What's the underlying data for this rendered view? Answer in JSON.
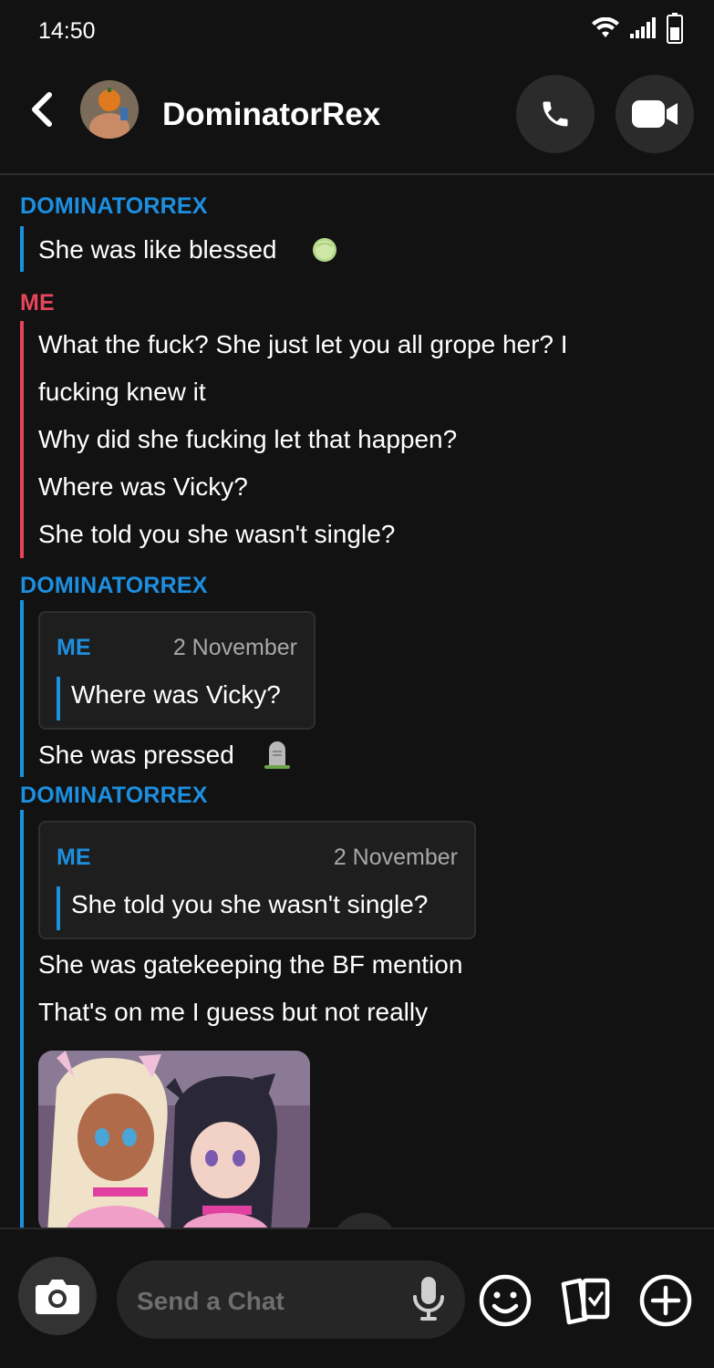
{
  "status_bar": {
    "time": "14:50",
    "icons": [
      "wifi-icon",
      "signal-icon",
      "battery-icon"
    ]
  },
  "header": {
    "contact_name": "DominatorRex",
    "buttons": [
      "back-icon",
      "phone-icon",
      "video-camera-icon"
    ]
  },
  "chat": {
    "messages": [
      {
        "sender": "DOMINATORREX",
        "lines": [
          "She was like blessed"
        ],
        "emoji": "melon-icon"
      },
      {
        "sender": "ME",
        "lines": [
          "What the fuck? She just let you all grope her? I",
          "fucking knew it",
          "Why did she fucking let that happen?",
          "Where was Vicky?",
          "She told you she wasn't single?"
        ]
      },
      {
        "sender": "DOMINATORREX",
        "quote": {
          "sender": "ME",
          "date": "2 November",
          "text": "Where was Vicky?"
        },
        "lines": [
          "She was pressed"
        ],
        "emoji": "headstone-icon"
      },
      {
        "sender": "DOMINATORREX",
        "quote": {
          "sender": "ME",
          "date": "2 November",
          "text": "She told you she wasn't single?"
        },
        "lines": [
          "She was gatekeeping the BF mention",
          "That's on me I guess but not really"
        ],
        "attachment": "anime-girls-sticker"
      }
    ]
  },
  "composer": {
    "placeholder": "Send a Chat",
    "icons": [
      "camera-icon",
      "microphone-icon",
      "smiley-icon",
      "cards-icon",
      "plus-icon"
    ]
  },
  "colors": {
    "background": "#121212",
    "them_accent": "#1d8fe0",
    "me_accent": "#e8445a",
    "bubble": "#1e1e1e",
    "input": "#262626"
  }
}
